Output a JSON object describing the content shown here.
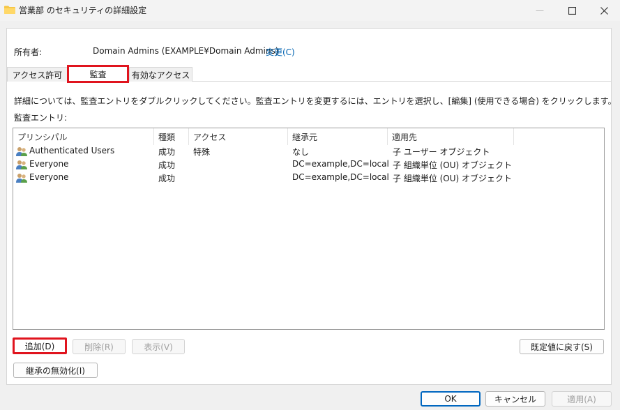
{
  "window": {
    "title": "営業部 のセキュリティの詳細設定",
    "min_glyph": "—",
    "max_glyph": "☐",
    "close_glyph": "✕"
  },
  "owner": {
    "label": "所有者:",
    "value": "Domain Admins (EXAMPLE¥Domain Admins)",
    "change_link": "変更(C)"
  },
  "tabs": [
    {
      "label": "アクセス許可"
    },
    {
      "label": "監査"
    },
    {
      "label": "有効なアクセス"
    }
  ],
  "description": "詳細については、監査エントリをダブルクリックしてください。監査エントリを変更するには、エントリを選択し、[編集] (使用できる場合) をクリックします。",
  "entries_label": "監査エントリ:",
  "columns": [
    "プリンシパル",
    "種類",
    "アクセス",
    "継承元",
    "適用先"
  ],
  "rows": [
    {
      "principal": "Authenticated Users",
      "type": "成功",
      "access": "特殊",
      "inherited": "なし",
      "applies": "子 ユーザー オブジェクト"
    },
    {
      "principal": "Everyone",
      "type": "成功",
      "access": "",
      "inherited": "DC=example,DC=local",
      "applies": "子 組織単位 (OU) オブジェクト"
    },
    {
      "principal": "Everyone",
      "type": "成功",
      "access": "",
      "inherited": "DC=example,DC=local",
      "applies": "子 組織単位 (OU) オブジェクト"
    }
  ],
  "buttons": {
    "add": "追加(D)",
    "remove": "削除(R)",
    "view": "表示(V)",
    "restore_default": "既定値に戻す(S)",
    "disable_inheritance": "継承の無効化(I)",
    "ok": "OK",
    "cancel": "キャンセル",
    "apply": "適用(A)"
  },
  "icons": {
    "folder": "folder-icon",
    "users": "users-icon"
  },
  "colors": {
    "highlight": "#e0141e",
    "link": "#0063b1",
    "folder": "#f5c542"
  }
}
